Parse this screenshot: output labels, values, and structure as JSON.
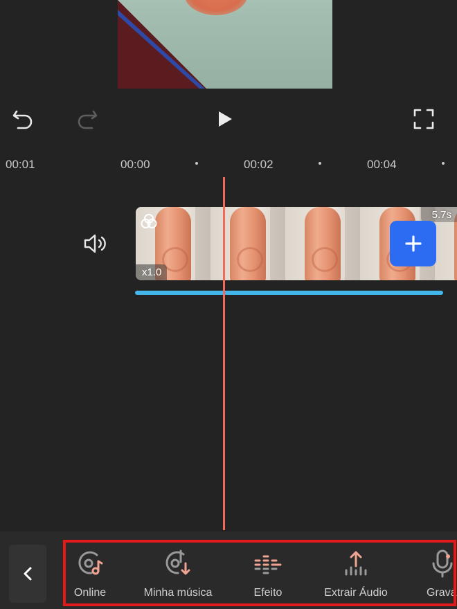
{
  "timeline": {
    "ticks": [
      "00:01",
      "00:00",
      "00:02",
      "00:04"
    ]
  },
  "clip": {
    "duration": "5.7s",
    "speed": "x1.0"
  },
  "toolbar": {
    "items": [
      {
        "label": "Online",
        "icon": "online-music-icon"
      },
      {
        "label": "Minha música",
        "icon": "my-music-download-icon"
      },
      {
        "label": "Efeito",
        "icon": "sound-effect-icon"
      },
      {
        "label": "Extrair Áudio",
        "icon": "extract-audio-icon"
      },
      {
        "label": "Gravar",
        "icon": "microphone-icon"
      }
    ]
  },
  "colors": {
    "background": "#232323",
    "playhead": "#f06b5c",
    "add_button": "#2c6cf3",
    "audio_line": "#43b6ec",
    "icon_accent": "#f0a594",
    "highlight_border": "#e51919"
  }
}
